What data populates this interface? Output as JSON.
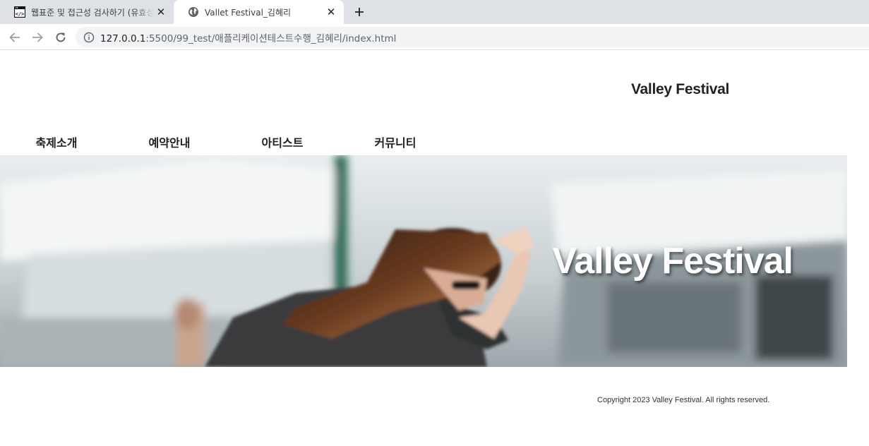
{
  "browser": {
    "tabs": [
      {
        "title": "웹표준 및 접근성 검사하기 (유효성 검사)",
        "active": false,
        "icon": "code-editor-icon"
      },
      {
        "title": "Vallet Festival_김혜리",
        "active": true,
        "icon": "globe-icon"
      }
    ],
    "address": {
      "url_host": "127.0.0.1",
      "url_rest": ":5500/99_test/애플리케이션테스트수행_김혜리/index.html"
    },
    "colors": {
      "tabstrip": "#dee1e6",
      "omnibox": "#f1f3f4"
    }
  },
  "site": {
    "logo": "Valley Festival",
    "nav": [
      {
        "label": "축제소개"
      },
      {
        "label": "예약안내"
      },
      {
        "label": "아티스트"
      },
      {
        "label": "커뮤니티"
      }
    ],
    "hero": {
      "title": "Valley Festival"
    },
    "footer": {
      "copyright": "Copyright 2023 Valley Festival. All rights reserved."
    }
  }
}
